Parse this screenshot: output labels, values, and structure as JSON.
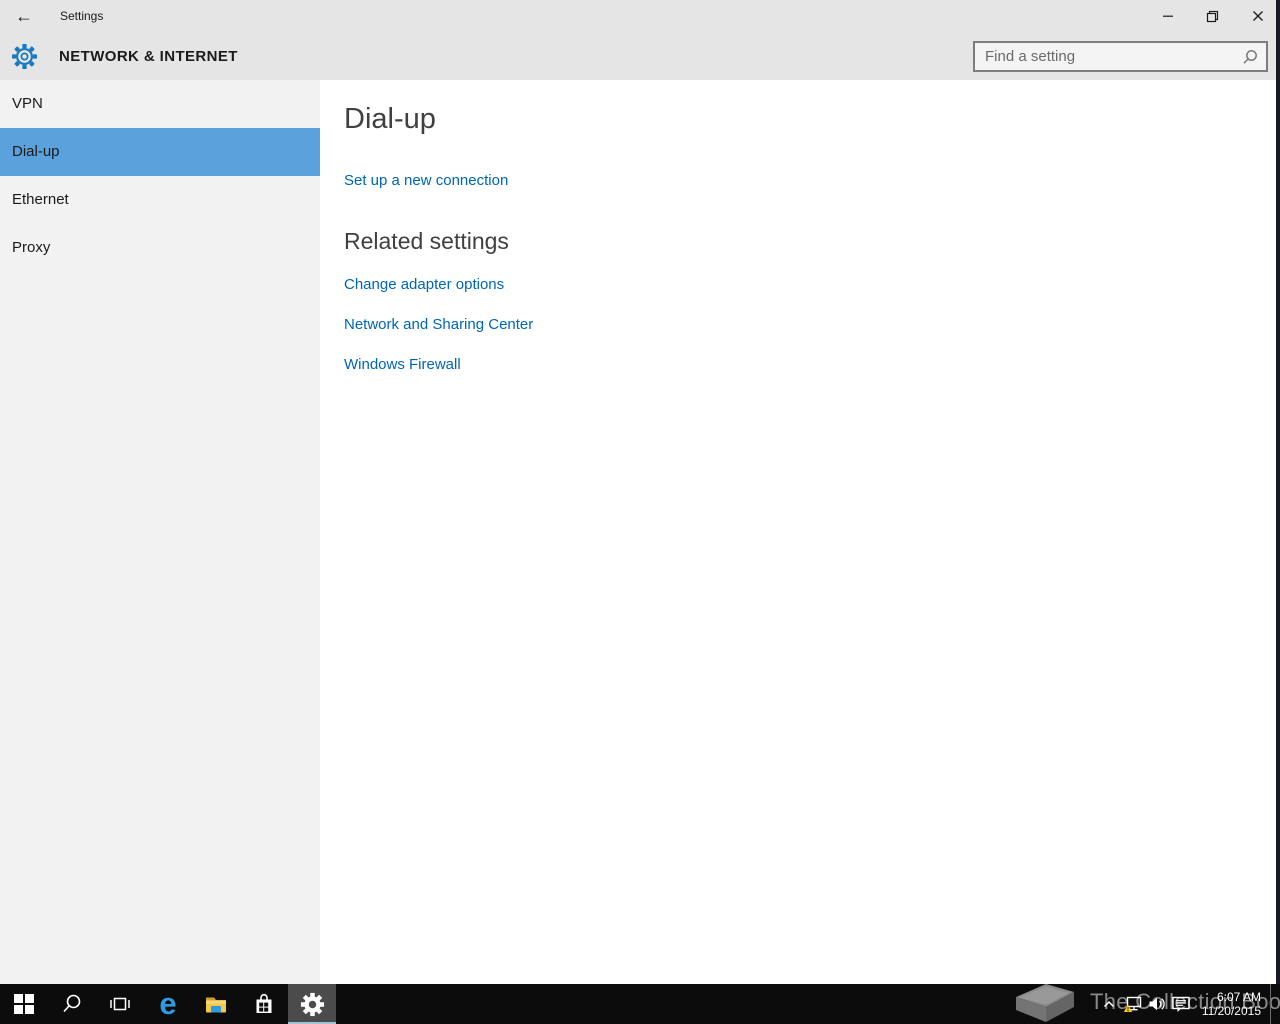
{
  "window": {
    "title": "Settings",
    "controls": {
      "minimize": "minimize",
      "restore": "restore",
      "close": "close"
    }
  },
  "header": {
    "section_title": "NETWORK & INTERNET",
    "search_placeholder": "Find a setting"
  },
  "sidebar": {
    "items": [
      {
        "label": "VPN",
        "selected": false
      },
      {
        "label": "Dial-up",
        "selected": true
      },
      {
        "label": "Ethernet",
        "selected": false
      },
      {
        "label": "Proxy",
        "selected": false
      }
    ]
  },
  "main": {
    "title": "Dial-up",
    "setup_link": "Set up a new connection",
    "related_heading": "Related settings",
    "related_links": [
      "Change adapter options",
      "Network and Sharing Center",
      "Windows Firewall"
    ]
  },
  "taskbar": {
    "buttons": [
      "start",
      "search",
      "task-view",
      "edge",
      "file-explorer",
      "store",
      "settings"
    ],
    "active_button": "settings",
    "tray": {
      "icons": [
        "chevron-up",
        "network-warning",
        "volume",
        "action-center"
      ],
      "time": "6:07 AM",
      "date": "11/20/2015"
    }
  },
  "watermark": {
    "text": "The Collection Book"
  },
  "icons": {
    "back": "←",
    "search": "magnifier",
    "gear": "gear",
    "warning": "yellow-triangle"
  },
  "colors": {
    "selection_blue": "#5ba1dc",
    "link_blue": "#0066b4",
    "header_bg": "#e5e5e5",
    "sidebar_bg": "#f2f2f2",
    "taskbar_bg": "#0c0c0c",
    "gear_blue": "#1779be",
    "warning_yellow": "#f8cb12"
  }
}
